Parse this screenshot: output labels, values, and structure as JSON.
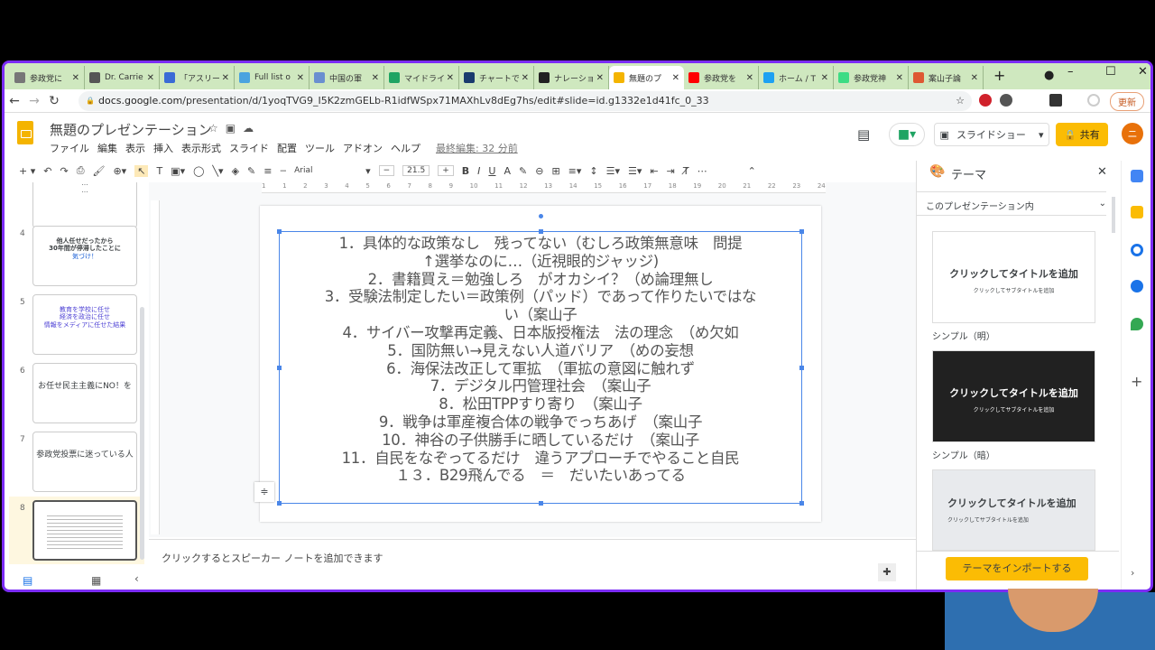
{
  "browser": {
    "tabs": [
      {
        "label": "参政党に",
        "icon": "tv-icon",
        "color": "#777"
      },
      {
        "label": "Dr. Carrie",
        "icon": "cat-icon",
        "color": "#555"
      },
      {
        "label": "「アスリー",
        "icon": "globe-icon",
        "color": "#3a6bd6"
      },
      {
        "label": "Full list o",
        "icon": "plus-icon",
        "color": "#4aa3df"
      },
      {
        "label": "中国の軍",
        "icon": "earth-icon",
        "color": "#6a8fd0"
      },
      {
        "label": "マイドライ",
        "icon": "drive-icon",
        "color": "#1fa463"
      },
      {
        "label": "チャートで",
        "icon": "chart-icon",
        "color": "#1a3b6e"
      },
      {
        "label": "ナレーショ",
        "icon": "image-icon",
        "color": "#222"
      },
      {
        "label": "無題のプ",
        "icon": "slides-icon",
        "color": "#f4b400",
        "active": true
      },
      {
        "label": "参政党を",
        "icon": "youtube-icon",
        "color": "#ff0000"
      },
      {
        "label": "ホーム / T",
        "icon": "twitter-icon",
        "color": "#1da1f2"
      },
      {
        "label": "参政党神",
        "icon": "android-icon",
        "color": "#3ddc84"
      },
      {
        "label": "案山子論",
        "icon": "duckduckgo-icon",
        "color": "#de5833"
      }
    ],
    "url_domain": "docs.google.com",
    "url_path": "/presentation/d/1yoqTVG9_I5K2zmGELb-R1idfWSpx71MAXhLv8dEg7hs/edit#slide=id.g1332e1d41fc_0_33",
    "update_label": "更新"
  },
  "doc": {
    "title": "無題のプレゼンテーション",
    "menus": [
      "ファイル",
      "編集",
      "表示",
      "挿入",
      "表示形式",
      "スライド",
      "配置",
      "ツール",
      "アドオン",
      "ヘルプ"
    ],
    "last_edit": "最終編集: 32 分前",
    "slideshow": "スライドショー",
    "share": "共有",
    "avatar": "ニ"
  },
  "toolbar": {
    "font": "Arial",
    "size": "21.5"
  },
  "ruler": [
    "1",
    "1",
    "2",
    "3",
    "4",
    "5",
    "6",
    "7",
    "8",
    "9",
    "10",
    "11",
    "12",
    "13",
    "14",
    "15",
    "16",
    "17",
    "18",
    "19",
    "20",
    "21",
    "22",
    "23",
    "24"
  ],
  "filmstrip": [
    {
      "num": "",
      "lines": [
        "…",
        "…"
      ]
    },
    {
      "num": "4",
      "lines": [
        "他人任せだったから",
        "30年間が停滞したことに",
        "気づけ！"
      ]
    },
    {
      "num": "5",
      "lines": [
        "教育を学校に任せ",
        "経済を政治に任せ",
        "情報をメディアに任せた結果"
      ]
    },
    {
      "num": "6",
      "lines": [
        "お任せ民主主義にNO！を"
      ]
    },
    {
      "num": "7",
      "lines": [
        "参政党投票に迷っている人"
      ]
    },
    {
      "num": "8",
      "lines": []
    }
  ],
  "slide": {
    "lines": [
      "1．具体的な政策なし　残ってない（むしろ政策無意味　問提",
      "↑選挙なのに…（近視眼的ジャッジ)",
      "2．書籍買え＝勉強しろ　がオカシイ？（め論理無し",
      "3．受験法制定したい＝政策例（パッド）であって作りたいではな",
      "い（案山子",
      "4．サイバー攻撃再定義、日本版授権法　法の理念　（め欠如",
      "5．国防無い→見えない人道バリア　（めの妄想",
      "6．海保法改正して軍拡　（軍拡の意図に触れず",
      "7．デジタル円管理社会　（案山子",
      "8．松田TPPすり寄り　（案山子",
      "9．戦争は軍産複合体の戦争でっちあげ　（案山子",
      "10．神谷の子供勝手に晒しているだけ　（案山子",
      "11．自民をなぞってるだけ　違うアプローチでやること自民",
      "１３．B29飛んでる　＝　だいたいあってる"
    ]
  },
  "notes": {
    "placeholder": "クリックするとスピーカー ノートを追加できます"
  },
  "theme_panel": {
    "title": "テーマ",
    "scope": "このプレゼンテーション内",
    "themes": [
      {
        "title": "クリックしてタイトルを追加",
        "subtitle": "クリックしてサブタイトルを追加",
        "name": "シンプル（明）"
      },
      {
        "title": "クリックしてタイトルを追加",
        "subtitle": "クリックしてサブタイトルを追加",
        "name": "シンプル（暗）"
      },
      {
        "title": "クリックしてタイトルを追加",
        "subtitle": "クリックしてサブタイトルを追加",
        "name": ""
      }
    ],
    "import": "テーマをインポートする"
  },
  "colors": {
    "accent": "#fbbc04",
    "selection": "#4a86e8",
    "frame": "#7b2cf5"
  }
}
